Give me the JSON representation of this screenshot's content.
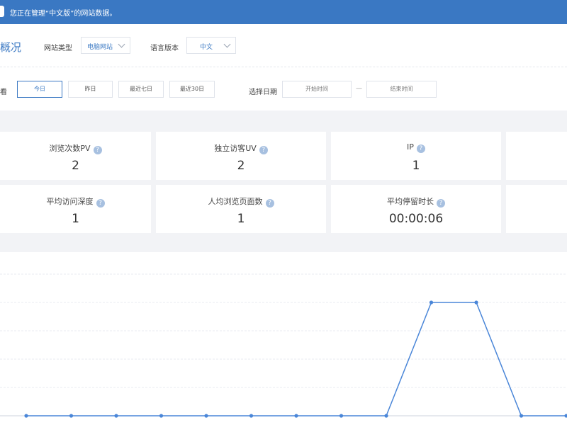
{
  "topbar": {
    "notice": "您正在管理“中文版”的网站数据。"
  },
  "filters": {
    "title": "概况",
    "site_type_label": "网站类型",
    "site_type_value": "电脑网站",
    "language_label": "语言版本",
    "language_value": "中文",
    "view_label": "看",
    "quick_ranges": [
      "今日",
      "昨日",
      "最近七日",
      "最近30日"
    ],
    "active_range": "今日",
    "date_label": "选择日期",
    "start_placeholder": "开始时间",
    "end_placeholder": "结束时间",
    "date_separator": "—"
  },
  "stats": [
    {
      "label": "浏览次数PV",
      "value": "2"
    },
    {
      "label": "独立访客UV",
      "value": "2"
    },
    {
      "label": "IP",
      "value": "1"
    },
    {
      "label": "平均访问深度",
      "value": "1"
    },
    {
      "label": "人均浏览页面数",
      "value": "1"
    },
    {
      "label": "平均停留时长",
      "value": "00:00:06"
    }
  ],
  "chart_data": {
    "type": "line",
    "x": [
      0,
      1,
      2,
      3,
      4,
      5,
      6,
      7,
      8,
      9,
      10,
      11,
      12
    ],
    "values": [
      0,
      0,
      0,
      0,
      0,
      0,
      0,
      0,
      0,
      1,
      1,
      0,
      0
    ],
    "ylim": [
      0,
      1.25
    ],
    "grid": true,
    "color": "#4a86d8"
  }
}
